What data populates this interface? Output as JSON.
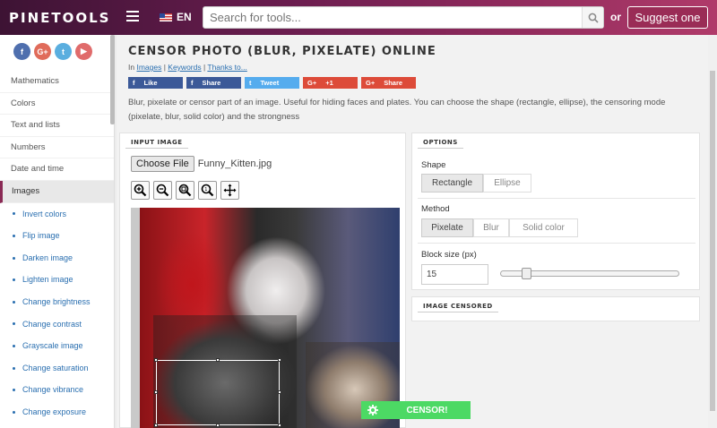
{
  "header": {
    "logo": "PINETOOLS",
    "lang": "EN",
    "search_placeholder": "Search for tools...",
    "or": "or",
    "suggest_label": "Suggest one"
  },
  "sidebar": {
    "social": [
      "f",
      "G+",
      "t",
      "▶"
    ],
    "items": [
      "Mathematics",
      "Colors",
      "Text and lists",
      "Numbers",
      "Date and time",
      "Images"
    ],
    "subitems": [
      "Invert colors",
      "Flip image",
      "Darken image",
      "Lighten image",
      "Change brightness",
      "Change contrast",
      "Grayscale image",
      "Change saturation",
      "Change vibrance",
      "Change exposure"
    ]
  },
  "page": {
    "title": "CENSOR PHOTO (BLUR, PIXELATE) ONLINE",
    "crumb_in": "In",
    "crumb_images": "Images",
    "crumb_keywords": "Keywords",
    "crumb_thanks": "Thanks to...",
    "share": {
      "like": "Like",
      "fb_share": "Share",
      "tweet": "Tweet",
      "gplus_one": "+1",
      "gplus_share": "Share"
    },
    "description": "Blur, pixelate or censor part of an image. Useful for hiding faces and plates. You can choose the shape (rectangle, ellipse), the censoring mode (pixelate, blur, solid color) and the strongness"
  },
  "input_panel": {
    "title": "INPUT IMAGE",
    "choose_file": "Choose File",
    "file_name": "Funny_Kitten.jpg"
  },
  "options": {
    "title": "OPTIONS",
    "shape_label": "Shape",
    "shape_options": [
      "Rectangle",
      "Ellipse"
    ],
    "shape_selected": "Rectangle",
    "method_label": "Method",
    "method_options": [
      "Pixelate",
      "Blur",
      "Solid color"
    ],
    "method_selected": "Pixelate",
    "block_label": "Block size (px)",
    "block_value": "15",
    "block_slider_fraction": 0.12
  },
  "censored_panel": {
    "title": "IMAGE CENSORED"
  },
  "censor_button": "CENSOR!",
  "colors": {
    "accent": "#8a2a55",
    "censor_green": "#4cd964",
    "link": "#2a6fb0"
  }
}
